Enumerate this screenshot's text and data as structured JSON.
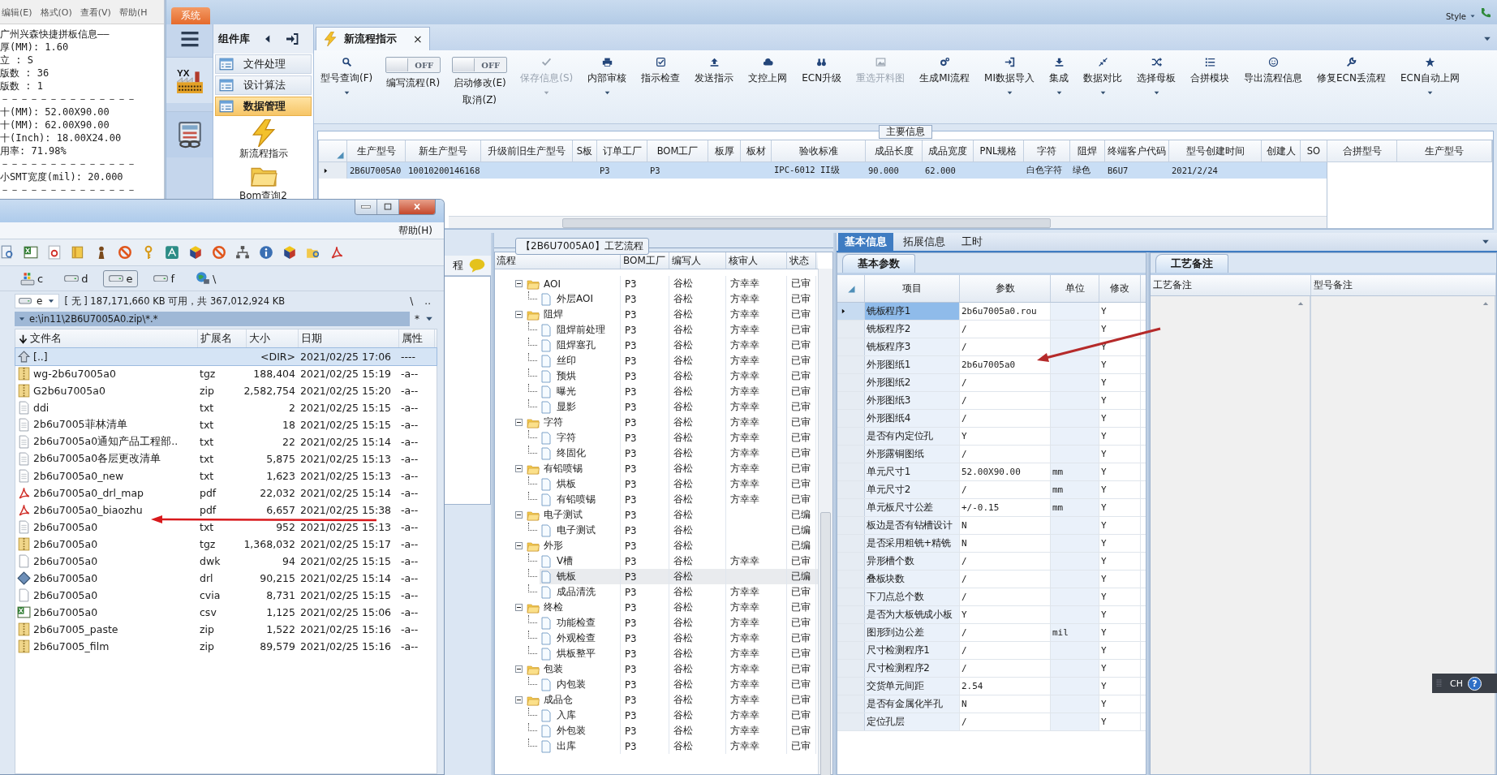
{
  "notepad": {
    "menu": [
      "编辑(E)",
      "格式(O)",
      "查看(V)",
      "帮助(H"
    ],
    "lines": [
      "广州兴森快捷拼板信息——",
      "厚(MM): 1.60",
      "立 : S",
      "版数 : 36",
      "版数 : 1",
      "－－－－－－－－－－－－－－",
      "十(MM): 52.00X90.00",
      "十(MM): 62.00X90.00",
      "十(Inch): 18.00X24.00",
      "用率: 71.98%",
      "－－－－－－－－－－－－－－",
      "小SMT宽度(mil): 20.000",
      "－－－－－－－－－－－－－－"
    ]
  },
  "app": {
    "system_tab": "系统",
    "style_menu": "Style",
    "iconbar": {
      "logo_text": "YX"
    },
    "component_library": {
      "title": "组件库",
      "items": [
        {
          "label": "文件处理",
          "selected": false
        },
        {
          "label": "设计算法",
          "selected": false
        },
        {
          "label": "数据管理",
          "selected": true
        }
      ],
      "launchers": [
        {
          "label": "新流程指示",
          "kind": "lightning"
        },
        {
          "label": "Bom查询2",
          "kind": "folder"
        }
      ]
    },
    "document_tab": {
      "label": "新流程指示",
      "close": "×"
    },
    "toolbar": [
      {
        "kind": "button",
        "label": "型号查询(F)",
        "disabled": false,
        "has_menu": true
      },
      {
        "kind": "toggle",
        "label": "编写流程(R)",
        "on": false,
        "switch_text": "OFF"
      },
      {
        "kind": "toggle",
        "label": "启动修改(E)",
        "second_line": "取消(Z)",
        "on": false,
        "switch_text": "OFF"
      },
      {
        "kind": "button",
        "label": "保存信息(S)",
        "disabled": true,
        "has_menu": true
      },
      {
        "kind": "button",
        "label": "内部审核",
        "disabled": false,
        "has_menu": true
      },
      {
        "kind": "button",
        "label": "指示检查",
        "disabled": false,
        "has_menu": false
      },
      {
        "kind": "button",
        "label": "发送指示",
        "disabled": false,
        "has_menu": false
      },
      {
        "kind": "button",
        "label": "文控上网",
        "disabled": false,
        "has_menu": false
      },
      {
        "kind": "button",
        "label": "ECN升级",
        "disabled": false,
        "has_menu": false
      },
      {
        "kind": "button",
        "label": "重选开料图",
        "disabled": true,
        "has_menu": false
      },
      {
        "kind": "button",
        "label": "生成MI流程",
        "disabled": false,
        "has_menu": false
      },
      {
        "kind": "button",
        "label": "MI数据导入",
        "disabled": false,
        "has_menu": true
      },
      {
        "kind": "button",
        "label": "集成",
        "disabled": false,
        "has_menu": true
      },
      {
        "kind": "button",
        "label": "数据对比",
        "disabled": false,
        "has_menu": true
      },
      {
        "kind": "button",
        "label": "选择母板",
        "disabled": false,
        "has_menu": true
      },
      {
        "kind": "button",
        "label": "合拼模块",
        "disabled": false,
        "has_menu": false
      },
      {
        "kind": "button",
        "label": "导出流程信息",
        "disabled": false,
        "has_menu": false
      },
      {
        "kind": "button",
        "label": "修复ECN丢流程",
        "disabled": false,
        "has_menu": false
      },
      {
        "kind": "button",
        "label": "ECN自动上网",
        "disabled": false,
        "has_menu": true
      }
    ],
    "main_info": {
      "title": "主要信息",
      "columns": [
        "生产型号",
        "新生产型号",
        "升级前旧生产型号",
        "S板",
        "订单工厂",
        "BOM工厂",
        "板厚",
        "板材",
        "验收标准",
        "成品长度",
        "成品宽度",
        "PNL规格",
        "字符",
        "阻焊",
        "终端客户代码",
        "型号创建时间",
        "创建人",
        "SO"
      ],
      "rows": [
        {
          "selected": true,
          "cells": [
            "2B6U7005A0",
            "10010200146168",
            null,
            null,
            "P3",
            "P3",
            null,
            null,
            "IPC-6012 II级",
            "90.000",
            "62.000",
            null,
            "白色字符",
            "绿色",
            "B6U7",
            "2021/2/24",
            null,
            null
          ]
        }
      ],
      "side_columns": [
        "合拼型号",
        "生产型号"
      ]
    },
    "left_panel": {
      "header": "程"
    },
    "process_flow": {
      "title": "【2B6U7005A0】工艺流程",
      "columns": [
        "流程",
        "BOM工厂",
        "编写人",
        "核审人",
        "状态"
      ],
      "steps": [
        {
          "name": "AOI",
          "bom": "P3",
          "writer": "谷松",
          "reviewer": "方幸幸",
          "status": "已审",
          "selected": false,
          "expanded": true,
          "children": [
            {
              "name": "外层AOI",
              "bom": "P3",
              "writer": "谷松",
              "reviewer": "方幸幸",
              "status": "已审",
              "selected": false
            }
          ]
        },
        {
          "name": "阻焊",
          "bom": "P3",
          "writer": "谷松",
          "reviewer": "方幸幸",
          "status": "已审",
          "selected": false,
          "expanded": true,
          "children": [
            {
              "name": "阻焊前处理",
              "bom": "P3",
              "writer": "谷松",
              "reviewer": "方幸幸",
              "status": "已审",
              "selected": false
            },
            {
              "name": "阻焊塞孔",
              "bom": "P3",
              "writer": "谷松",
              "reviewer": "方幸幸",
              "status": "已审",
              "selected": false
            },
            {
              "name": "丝印",
              "bom": "P3",
              "writer": "谷松",
              "reviewer": "方幸幸",
              "status": "已审",
              "selected": false
            },
            {
              "name": "预烘",
              "bom": "P3",
              "writer": "谷松",
              "reviewer": "方幸幸",
              "status": "已审",
              "selected": false
            },
            {
              "name": "曝光",
              "bom": "P3",
              "writer": "谷松",
              "reviewer": "方幸幸",
              "status": "已审",
              "selected": false
            },
            {
              "name": "显影",
              "bom": "P3",
              "writer": "谷松",
              "reviewer": "方幸幸",
              "status": "已审",
              "selected": false
            }
          ]
        },
        {
          "name": "字符",
          "bom": "P3",
          "writer": "谷松",
          "reviewer": "方幸幸",
          "status": "已审",
          "selected": false,
          "expanded": true,
          "children": [
            {
              "name": "字符",
              "bom": "P3",
              "writer": "谷松",
              "reviewer": "方幸幸",
              "status": "已审",
              "selected": false
            },
            {
              "name": "终固化",
              "bom": "P3",
              "writer": "谷松",
              "reviewer": "方幸幸",
              "status": "已审",
              "selected": false
            }
          ]
        },
        {
          "name": "有铅喷锡",
          "bom": "P3",
          "writer": "谷松",
          "reviewer": "方幸幸",
          "status": "已审",
          "selected": false,
          "expanded": true,
          "children": [
            {
              "name": "烘板",
              "bom": "P3",
              "writer": "谷松",
              "reviewer": "方幸幸",
              "status": "已审",
              "selected": false
            },
            {
              "name": "有铅喷锡",
              "bom": "P3",
              "writer": "谷松",
              "reviewer": "方幸幸",
              "status": "已审",
              "selected": false
            }
          ]
        },
        {
          "name": "电子测试",
          "bom": "P3",
          "writer": "谷松",
          "status": "已编",
          "selected": false,
          "expanded": true,
          "children": [
            {
              "name": "电子测试",
              "bom": "P3",
              "writer": "谷松",
              "status": "已编",
              "selected": false
            }
          ]
        },
        {
          "name": "外形",
          "bom": "P3",
          "writer": "谷松",
          "status": "已编",
          "selected": false,
          "expanded": true,
          "children": [
            {
              "name": "V槽",
              "bom": "P3",
              "writer": "谷松",
              "reviewer": "方幸幸",
              "status": "已审",
              "selected": false
            },
            {
              "name": "铣板",
              "bom": "P3",
              "writer": "谷松",
              "status": "已编",
              "selected": true
            },
            {
              "name": "成品清洗",
              "bom": "P3",
              "writer": "谷松",
              "reviewer": "方幸幸",
              "status": "已审",
              "selected": false
            }
          ]
        },
        {
          "name": "终检",
          "bom": "P3",
          "writer": "谷松",
          "reviewer": "方幸幸",
          "status": "已审",
          "selected": false,
          "expanded": true,
          "children": [
            {
              "name": "功能检查",
              "bom": "P3",
              "writer": "谷松",
              "reviewer": "方幸幸",
              "status": "已审",
              "selected": false
            },
            {
              "name": "外观检查",
              "bom": "P3",
              "writer": "谷松",
              "reviewer": "方幸幸",
              "status": "已审",
              "selected": false
            },
            {
              "name": "烘板整平",
              "bom": "P3",
              "writer": "谷松",
              "reviewer": "方幸幸",
              "status": "已审",
              "selected": false
            }
          ]
        },
        {
          "name": "包装",
          "bom": "P3",
          "writer": "谷松",
          "reviewer": "方幸幸",
          "status": "已审",
          "selected": false,
          "expanded": true,
          "children": [
            {
              "name": "内包装",
              "bom": "P3",
              "writer": "谷松",
              "reviewer": "方幸幸",
              "status": "已审",
              "selected": false
            }
          ]
        },
        {
          "name": "成品仓",
          "bom": "P3",
          "writer": "谷松",
          "reviewer": "方幸幸",
          "status": "已审",
          "selected": false,
          "expanded": true,
          "children": [
            {
              "name": "入库",
              "bom": "P3",
              "writer": "谷松",
              "reviewer": "方幸幸",
              "status": "已审",
              "selected": false
            },
            {
              "name": "外包装",
              "bom": "P3",
              "writer": "谷松",
              "reviewer": "方幸幸",
              "status": "已审",
              "selected": false
            },
            {
              "name": "出库",
              "bom": "P3",
              "writer": "谷松",
              "reviewer": "方幸幸",
              "status": "已审",
              "selected": false
            }
          ]
        }
      ]
    },
    "detail": {
      "tabs": [
        {
          "label": "基本信息",
          "selected": true
        },
        {
          "label": "拓展信息",
          "selected": false
        },
        {
          "label": "工时",
          "selected": false
        }
      ],
      "params": {
        "tab": "基本参数",
        "columns": [
          "项目",
          "参数",
          "单位",
          "修改"
        ],
        "rows": [
          {
            "item": "铣板程序1",
            "value": "2b6u7005a0.rou",
            "modify": "Y",
            "selected": true
          },
          {
            "item": "铣板程序2",
            "value": "/",
            "modify": "Y",
            "selected": false
          },
          {
            "item": "铣板程序3",
            "value": "/",
            "modify": "Y",
            "selected": false
          },
          {
            "item": "外形图纸1",
            "value": "2b6u7005a0",
            "modify": "Y",
            "selected": false
          },
          {
            "item": "外形图纸2",
            "value": "/",
            "modify": "Y",
            "selected": false
          },
          {
            "item": "外形图纸3",
            "value": "/",
            "modify": "Y",
            "selected": false
          },
          {
            "item": "外形图纸4",
            "value": "/",
            "modify": "Y",
            "selected": false
          },
          {
            "item": "是否有内定位孔",
            "value": "Y",
            "modify": "Y",
            "selected": false
          },
          {
            "item": "外形露铜图纸",
            "value": "/",
            "modify": "Y",
            "selected": false
          },
          {
            "item": "单元尺寸1",
            "value": "52.00X90.00",
            "unit": "mm",
            "modify": "Y",
            "selected": false
          },
          {
            "item": "单元尺寸2",
            "value": "/",
            "unit": "mm",
            "modify": "Y",
            "selected": false
          },
          {
            "item": "单元板尺寸公差",
            "value": "+/-0.15",
            "unit": "mm",
            "modify": "Y",
            "selected": false
          },
          {
            "item": "板边是否有钻槽设计",
            "value": "N",
            "modify": "Y",
            "selected": false
          },
          {
            "item": "是否采用粗铣+精铣",
            "value": "N",
            "modify": "Y",
            "selected": false
          },
          {
            "item": "异形槽个数",
            "value": "/",
            "modify": "Y",
            "selected": false
          },
          {
            "item": "叠板块数",
            "value": "/",
            "modify": "Y",
            "selected": false
          },
          {
            "item": "下刀点总个数",
            "value": "/",
            "modify": "Y",
            "selected": false
          },
          {
            "item": "是否为大板铣成小板",
            "value": "Y",
            "modify": "Y",
            "selected": false
          },
          {
            "item": "图形到边公差",
            "value": "/",
            "unit": "mil",
            "modify": "Y",
            "selected": false
          },
          {
            "item": "尺寸检测程序1",
            "value": "/",
            "modify": "Y",
            "selected": false
          },
          {
            "item": "尺寸检测程序2",
            "value": "/",
            "modify": "Y",
            "selected": false
          },
          {
            "item": "交货单元间距",
            "value": "2.54",
            "modify": "Y",
            "selected": false
          },
          {
            "item": "是否有金属化半孔",
            "value": "N",
            "modify": "Y",
            "selected": false
          },
          {
            "item": "定位孔层",
            "value": "/",
            "modify": "Y",
            "selected": false
          }
        ]
      },
      "notes": {
        "tab": "工艺备注",
        "columns": [
          "工艺备注",
          "型号备注"
        ]
      }
    }
  },
  "file_manager": {
    "menu": [
      "帮助(H)"
    ],
    "drives": [
      {
        "label": "c",
        "kind": "system",
        "selected": false
      },
      {
        "label": "d",
        "kind": "disk",
        "selected": false
      },
      {
        "label": "e",
        "kind": "disk",
        "selected": true
      },
      {
        "label": "f",
        "kind": "disk",
        "selected": false
      },
      {
        "label": "\\",
        "kind": "network",
        "selected": false
      }
    ],
    "drive_combo": "e",
    "free_space": "[ 无 ]  187,171,660 KB 可用，共 367,012,924 KB",
    "root_button": "\\",
    "up_button": "..",
    "path": "e:\\in11\\2B6U7005A0.zip\\*.*",
    "filter": "*",
    "columns": [
      "文件名",
      "扩展名",
      "大小",
      "日期",
      "属性"
    ],
    "files": [
      {
        "name": "[..]",
        "size": "<DIR>",
        "date": "2021/02/25 17:06",
        "attr": "----",
        "kind": "up",
        "selected": true
      },
      {
        "name": "wg-2b6u7005a0",
        "ext": "tgz",
        "size": "188,404",
        "date": "2021/02/25 15:19",
        "attr": "-a--",
        "kind": "archive",
        "selected": false
      },
      {
        "name": "G2b6u7005a0",
        "ext": "zip",
        "size": "2,582,754",
        "date": "2021/02/25 15:20",
        "attr": "-a--",
        "kind": "archive",
        "selected": false
      },
      {
        "name": "ddi",
        "ext": "txt",
        "size": "2",
        "date": "2021/02/25 15:15",
        "attr": "-a--",
        "kind": "text",
        "selected": false
      },
      {
        "name": "2b6u7005菲林清单",
        "ext": "txt",
        "size": "18",
        "date": "2021/02/25 15:15",
        "attr": "-a--",
        "kind": "text",
        "selected": false
      },
      {
        "name": "2b6u7005a0通知产品工程部..",
        "ext": "txt",
        "size": "22",
        "date": "2021/02/25 15:14",
        "attr": "-a--",
        "kind": "text",
        "selected": false
      },
      {
        "name": "2b6u7005a0各层更改清单",
        "ext": "txt",
        "size": "5,875",
        "date": "2021/02/25 15:13",
        "attr": "-a--",
        "kind": "text",
        "selected": false
      },
      {
        "name": "2b6u7005a0_new",
        "ext": "txt",
        "size": "1,623",
        "date": "2021/02/25 15:13",
        "attr": "-a--",
        "kind": "text",
        "selected": false
      },
      {
        "name": "2b6u7005a0_drl_map",
        "ext": "pdf",
        "size": "22,032",
        "date": "2021/02/25 15:14",
        "attr": "-a--",
        "kind": "pdf",
        "selected": false
      },
      {
        "name": "2b6u7005a0_biaozhu",
        "ext": "pdf",
        "size": "6,657",
        "date": "2021/02/25 15:38",
        "attr": "-a--",
        "kind": "pdf",
        "selected": false
      },
      {
        "name": "2b6u7005a0",
        "ext": "txt",
        "size": "952",
        "date": "2021/02/25 15:13",
        "attr": "-a--",
        "kind": "text",
        "selected": false
      },
      {
        "name": "2b6u7005a0",
        "ext": "tgz",
        "size": "1,368,032",
        "date": "2021/02/25 15:17",
        "attr": "-a--",
        "kind": "archive",
        "selected": false
      },
      {
        "name": "2b6u7005a0",
        "ext": "dwk",
        "size": "94",
        "date": "2021/02/25 15:15",
        "attr": "-a--",
        "kind": "file",
        "selected": false
      },
      {
        "name": "2b6u7005a0",
        "ext": "drl",
        "size": "90,215",
        "date": "2021/02/25 15:14",
        "attr": "-a--",
        "kind": "drill",
        "selected": false
      },
      {
        "name": "2b6u7005a0",
        "ext": "cvia",
        "size": "8,731",
        "date": "2021/02/25 15:15",
        "attr": "-a--",
        "kind": "file",
        "selected": false
      },
      {
        "name": "2b6u7005a0",
        "ext": "csv",
        "size": "1,125",
        "date": "2021/02/25 15:06",
        "attr": "-a--",
        "kind": "sheet",
        "selected": false
      },
      {
        "name": "2b6u7005_paste",
        "ext": "zip",
        "size": "1,522",
        "date": "2021/02/25 15:16",
        "attr": "-a--",
        "kind": "archive",
        "selected": false
      },
      {
        "name": "2b6u7005_film",
        "ext": "zip",
        "size": "89,579",
        "date": "2021/02/25 15:16",
        "attr": "-a--",
        "kind": "archive",
        "selected": false
      }
    ]
  },
  "ime_bar": {
    "language": "CH",
    "help": "?"
  }
}
